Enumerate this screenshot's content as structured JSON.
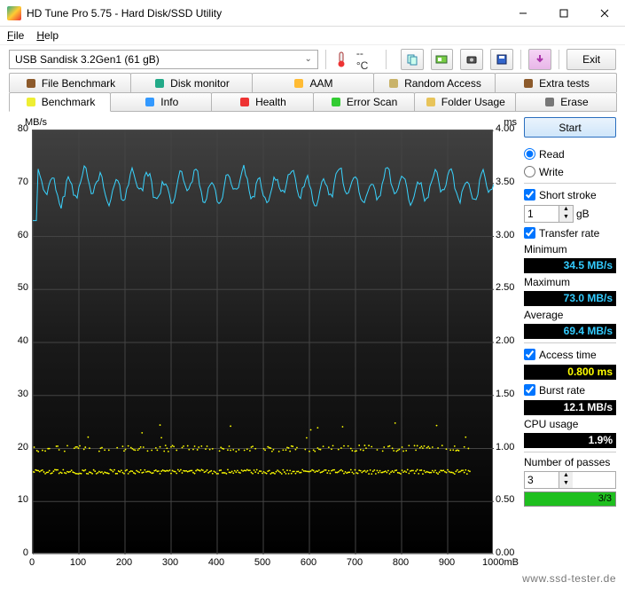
{
  "window": {
    "title": "HD Tune Pro 5.75 - Hard Disk/SSD Utility"
  },
  "menu": {
    "file": "File",
    "help": "Help"
  },
  "toolbar": {
    "drive": "USB Sandisk 3.2Gen1 (61 gB)",
    "temp_value": "--",
    "temp_unit": "°C",
    "exit": "Exit"
  },
  "tabs_upper": [
    {
      "icon": "file-benchmark-icon",
      "label": "File Benchmark"
    },
    {
      "icon": "disk-monitor-icon",
      "label": "Disk monitor"
    },
    {
      "icon": "aam-icon",
      "label": "AAM"
    },
    {
      "icon": "random-access-icon",
      "label": "Random Access"
    },
    {
      "icon": "extra-tests-icon",
      "label": "Extra tests"
    }
  ],
  "tabs_lower": [
    {
      "icon": "benchmark-icon",
      "label": "Benchmark",
      "active": true
    },
    {
      "icon": "info-icon",
      "label": "Info"
    },
    {
      "icon": "health-icon",
      "label": "Health"
    },
    {
      "icon": "error-scan-icon",
      "label": "Error Scan"
    },
    {
      "icon": "folder-usage-icon",
      "label": "Folder Usage"
    },
    {
      "icon": "erase-icon",
      "label": "Erase"
    }
  ],
  "side": {
    "start": "Start",
    "read": "Read",
    "write": "Write",
    "short_stroke": "Short stroke",
    "short_stroke_value": "1",
    "short_stroke_unit": "gB",
    "transfer_rate": "Transfer rate",
    "minimum": "Minimum",
    "minimum_v": "34.5 MB/s",
    "maximum": "Maximum",
    "maximum_v": "73.0 MB/s",
    "average": "Average",
    "average_v": "69.4 MB/s",
    "access_time": "Access time",
    "access_time_v": "0.800 ms",
    "burst_rate": "Burst rate",
    "burst_rate_v": "12.1 MB/s",
    "cpu_usage": "CPU usage",
    "cpu_usage_v": "1.9%",
    "num_passes": "Number of passes",
    "num_passes_v": "3",
    "progress_text": "3/3",
    "progress_pct": 100
  },
  "chart_data": {
    "type": "line",
    "left_axis": {
      "label": "MB/s",
      "min": 0,
      "max": 80,
      "ticks": [
        0,
        10,
        20,
        30,
        40,
        50,
        60,
        70,
        80
      ]
    },
    "right_axis": {
      "label": "ms",
      "min": 0,
      "max": 4.0,
      "ticks": [
        0.0,
        0.5,
        1.0,
        1.5,
        2.0,
        2.5,
        3.0,
        3.5,
        4.0
      ]
    },
    "x_axis": {
      "min": 0,
      "max": 1000,
      "ticks": [
        0,
        100,
        200,
        300,
        400,
        500,
        600,
        700,
        800,
        900
      ],
      "unit": "1000mB"
    },
    "series": [
      {
        "name": "Transfer rate",
        "axis": "left",
        "color": "#3cf",
        "approx_mean": 69.4,
        "approx_min": 34.5,
        "approx_max": 73.0,
        "note": "noisy line oscillating between ~67 and ~73 MB/s across full range; brief dip to ~34 near x=0"
      },
      {
        "name": "Access time",
        "axis": "right",
        "color": "#ff0",
        "clusters": [
          {
            "y_ms": 0.8,
            "density": "dense band across 0–950"
          },
          {
            "y_ms": 1.0,
            "density": "sparser band across 0–950"
          }
        ],
        "note": "scatter of yellow dots, main band ~0.8ms, secondary ~1.0ms, occasional outliers up to ~1.2ms"
      }
    ]
  },
  "watermark": "www.ssd-tester.de"
}
